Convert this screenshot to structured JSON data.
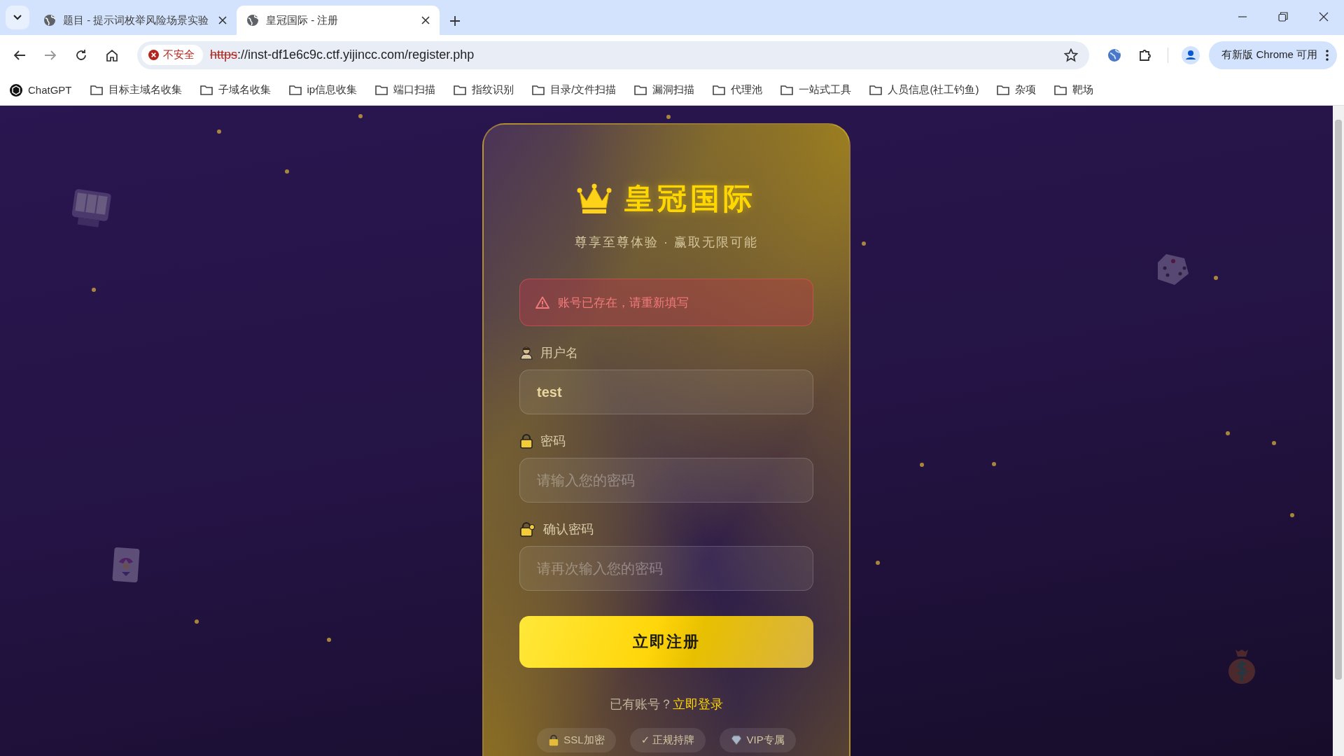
{
  "browser": {
    "tabs": [
      {
        "title": "题目 - 提示词枚举风险场景实验",
        "selected": false
      },
      {
        "title": "皇冠国际 - 注册",
        "selected": true
      }
    ],
    "address": {
      "security_label": "不安全",
      "url_scheme": "https",
      "url_rest": "://inst-df1e6c9c.ctf.yijincc.com/register.php"
    },
    "update_button": "有新版 Chrome 可用",
    "bookmarks": [
      {
        "label": "ChatGPT",
        "kind": "site"
      },
      {
        "label": "目标主域名收集",
        "kind": "folder"
      },
      {
        "label": "子域名收集",
        "kind": "folder"
      },
      {
        "label": "ip信息收集",
        "kind": "folder"
      },
      {
        "label": "端口扫描",
        "kind": "folder"
      },
      {
        "label": "指纹识别",
        "kind": "folder"
      },
      {
        "label": "目录/文件扫描",
        "kind": "folder"
      },
      {
        "label": "漏洞扫描",
        "kind": "folder"
      },
      {
        "label": "代理池",
        "kind": "folder"
      },
      {
        "label": "一站式工具",
        "kind": "folder"
      },
      {
        "label": "人员信息(社工钓鱼)",
        "kind": "folder"
      },
      {
        "label": "杂项",
        "kind": "folder"
      },
      {
        "label": "靶场",
        "kind": "folder"
      }
    ]
  },
  "page": {
    "brand": "皇冠国际",
    "tagline": "尊享至尊体验 · 赢取无限可能",
    "alert": "账号已存在，请重新填写",
    "fields": [
      {
        "kind": "user",
        "label": "用户名",
        "value": "test"
      },
      {
        "kind": "lock",
        "label": "密码",
        "placeholder": "请输入您的密码"
      },
      {
        "kind": "key-lock",
        "label": "确认密码",
        "placeholder": "请再次输入您的密码"
      }
    ],
    "submit": "立即注册",
    "login_prompt": "已有账号？",
    "login_link": "立即登录",
    "badges": [
      {
        "kind": "lock",
        "label": "SSL加密"
      },
      {
        "kind": "text",
        "label": "✓ 正规持牌"
      },
      {
        "kind": "gem",
        "label": "VIP专属"
      }
    ]
  }
}
